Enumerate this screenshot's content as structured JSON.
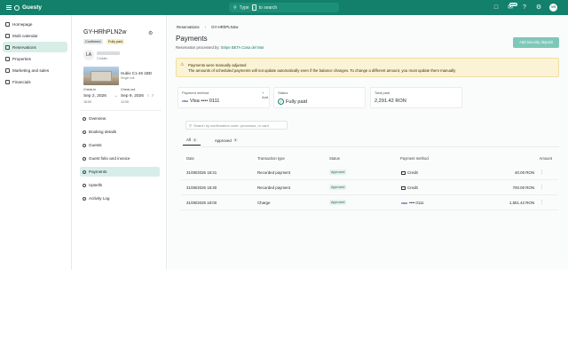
{
  "topbar": {
    "brand": "Guesty",
    "search_placeholder_pre": "Type",
    "search_key": "/",
    "search_placeholder_post": "to search",
    "new_badge": "NEW",
    "user_initials": "VR"
  },
  "leftnav": {
    "items": [
      {
        "label": "Homepage",
        "icon": "home-icon"
      },
      {
        "label": "Multi calendar",
        "icon": "calendar-icon"
      },
      {
        "label": "Reservations",
        "icon": "reservations-icon"
      },
      {
        "label": "Properties",
        "icon": "properties-icon"
      },
      {
        "label": "Marketing and sales",
        "icon": "marketing-icon"
      },
      {
        "label": "Financials",
        "icon": "financials-icon"
      }
    ],
    "active": "Reservations"
  },
  "reservation": {
    "code": "GY-HRhPLN2w",
    "status_confirmed": "Confirmed",
    "status_paid": "Fully paid",
    "guest_initials": "LA",
    "guest_sub": "2 Adults",
    "listing_name": "Hubix C1-46 1BD",
    "listing_sub": "Single unit",
    "checkin_label": "Check-in",
    "checkin_date": "Sep 2, 2026",
    "checkin_time": "15:00",
    "checkout_label": "Check-out",
    "checkout_date": "Sep 9, 2026",
    "checkout_time": "12:00",
    "nights": "7",
    "menu": [
      {
        "label": "Overview",
        "icon": "overview-icon"
      },
      {
        "label": "Booking details",
        "icon": "booking-icon"
      },
      {
        "label": "Guests",
        "icon": "guests-icon"
      },
      {
        "label": "Guest folio and invoice",
        "icon": "invoice-icon"
      },
      {
        "label": "Payments",
        "icon": "payments-icon"
      },
      {
        "label": "Upsells",
        "icon": "upsells-icon"
      },
      {
        "label": "Activity Log",
        "icon": "activity-icon"
      }
    ],
    "active_menu": "Payments"
  },
  "main": {
    "breadcrumb": [
      "Reservations",
      "GY-HRhPLN2w"
    ],
    "title": "Payments",
    "processed_prefix": "Reservation processed by:",
    "processed_link": "Stripe BETA Casa del Mar",
    "add_button": "Add security deposit",
    "warning_title": "Payments were manually adjusted",
    "warning_body": "The amounts of scheduled payments will not update automatically even if the balance changes. To change a different amount, you must update them manually",
    "summary": {
      "payment_method_label": "Payment method",
      "card_brand": "VISA",
      "payment_method_value": "Visa •••• 0111",
      "add_label": "+ Add",
      "status_label": "Status",
      "status_value": "Fully paid",
      "total_label": "Total paid",
      "total_value": "2,291.42 RON"
    },
    "search_placeholder": "Search by confirmation code, processor, or card",
    "tabs": [
      {
        "label": "All",
        "count": "3"
      },
      {
        "label": "Approved",
        "count": "3"
      }
    ],
    "table": {
      "headers": [
        "Date",
        "Transaction type",
        "Status",
        "Payment method",
        "Amount"
      ],
      "rows": [
        {
          "date": "31/08/2026 18:31",
          "type": "Recorded payment",
          "status": "Approved",
          "method": "Credit",
          "method_icon": "credit-card-icon",
          "amount": "40.00 RON"
        },
        {
          "date": "31/08/2026 18:30",
          "type": "Recorded payment",
          "status": "Approved",
          "method": "Credit",
          "method_icon": "credit-card-icon",
          "amount": "700.00 RON"
        },
        {
          "date": "31/08/2026 18:00",
          "type": "Charge",
          "status": "Approved",
          "method": "•••• 0111",
          "method_icon": "visa-icon",
          "amount": "1,551.42 RON"
        }
      ]
    }
  },
  "colors": {
    "brand": "#12806b",
    "active_bg": "#d7eee8",
    "warning_bg": "#fbf3d6"
  }
}
